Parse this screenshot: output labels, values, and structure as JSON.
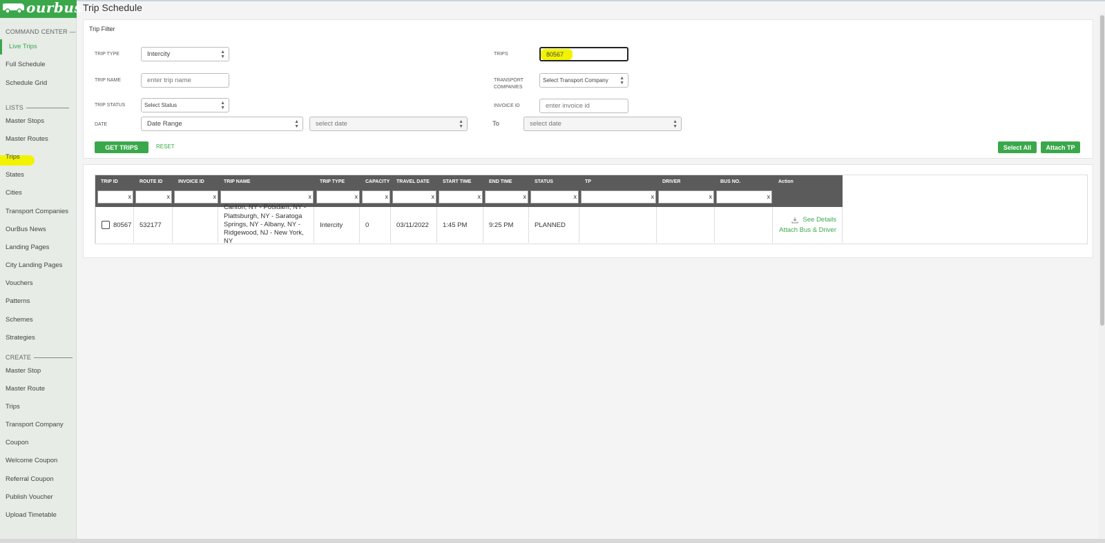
{
  "app": {
    "logo": "ourbus",
    "page_title": "Trip Schedule"
  },
  "sidebar": {
    "sections": [
      {
        "label": "COMMAND CENTER —",
        "key": "command"
      },
      {
        "label": "LISTS",
        "key": "lists"
      },
      {
        "label": "CREATE",
        "key": "create"
      }
    ],
    "command_items": [
      "Live Trips",
      "Full Schedule",
      "Schedule Grid"
    ],
    "list_items": [
      "Master Stops",
      "Master Routes",
      "Trips",
      "States",
      "Cities",
      "Transport Companies",
      "OurBus News",
      "Landing Pages",
      "City Landing Pages",
      "Vouchers",
      "Patterns",
      "Schemes",
      "Strategies"
    ],
    "create_items": [
      "Master Stop",
      "Master Route",
      "Trips",
      "Transport Company",
      "Coupon",
      "Welcome Coupon",
      "Referral Coupon",
      "Publish Voucher",
      "Upload Timetable"
    ],
    "active_item": "Live Trips",
    "highlighted_item": "Trips"
  },
  "filter": {
    "title": "Trip Filter",
    "labels": {
      "trip_type": "TRIP TYPE",
      "trip_name": "TRIP NAME",
      "trip_status": "TRIP STATUS",
      "date": "DATE",
      "trips": "TRIPS",
      "transport_companies_1": "TRANSPORT",
      "transport_companies_2": "COMPANIES",
      "invoice_id": "INVOICE ID",
      "to": "To"
    },
    "trip_type_value": "Intercity",
    "trip_name_placeholder": "enter trip name",
    "trip_status_value": "Select Status",
    "date_mode_value": "Date Range",
    "date_from_value": "select date",
    "date_to_value": "select date",
    "trips_value": "80567",
    "transport_company_value": "Select Transport Company",
    "invoice_placeholder": "enter invoice id",
    "get_trips_label": "GET TRIPS",
    "reset_label": "RESET",
    "select_all_label": "Select All",
    "attach_tp_label": "Attach TP"
  },
  "table": {
    "columns": [
      "TRIP ID",
      "ROUTE ID",
      "INVOICE ID",
      "TRIP NAME",
      "TRIP TYPE",
      "CAPACITY",
      "TRAVEL DATE",
      "START TIME",
      "END TIME",
      "STATUS",
      "TP",
      "DRIVER",
      "BUS NO.",
      "Action"
    ],
    "filter_clear": "x",
    "rows": [
      {
        "trip_id": "80567",
        "route_id": "532177",
        "invoice_id": "",
        "trip_name_lines": [
          "Canton, NY - Potsdam, NY -",
          "Plattsburgh, NY - Saratoga",
          "Springs, NY - Albany, NY -",
          "Ridgewood, NJ - New York, NY"
        ],
        "trip_type": "Intercity",
        "capacity": "0",
        "travel_date": "03/11/2022",
        "start_time": "1:45 PM",
        "end_time": "9:25 PM",
        "status": "PLANNED",
        "tp": "",
        "driver": "",
        "bus_no": "",
        "action_details": "See Details",
        "action_attach": "Attach Bus & Driver"
      }
    ]
  },
  "colors": {
    "brand_green": "#3aa84a",
    "header_gray": "#5b5b5b",
    "highlight_yellow": "#f2f300"
  }
}
